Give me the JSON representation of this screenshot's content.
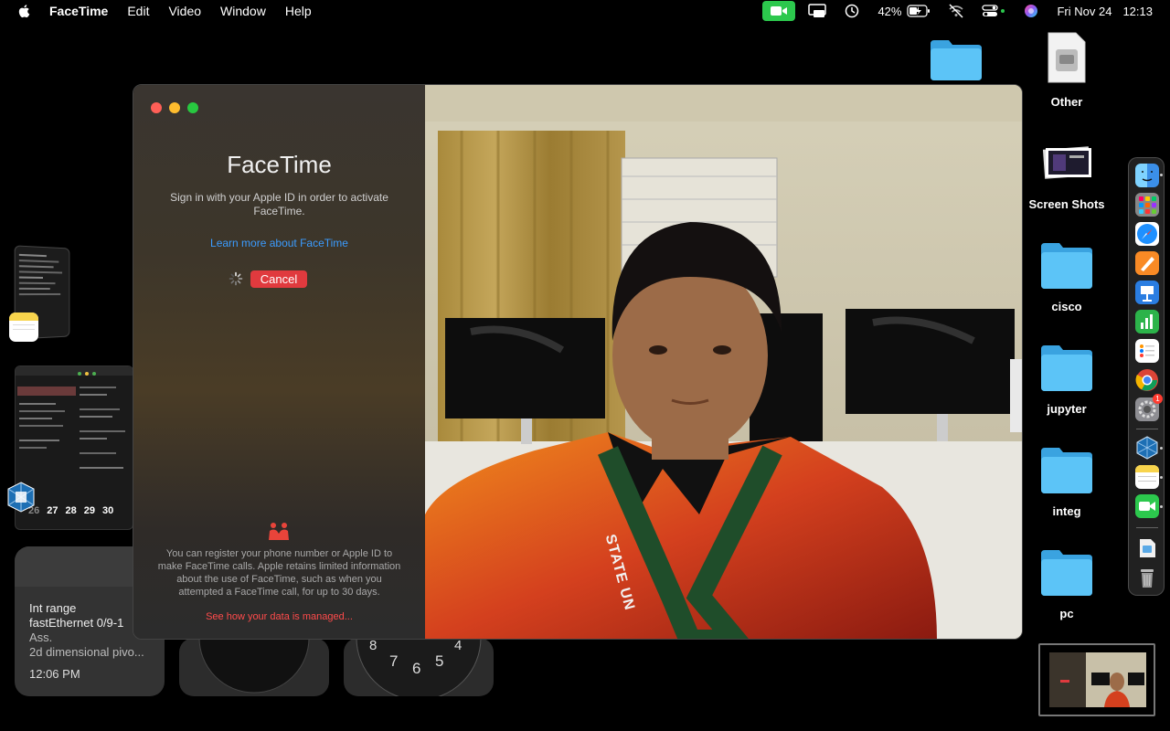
{
  "menubar": {
    "apple_icon": "apple-logo-icon",
    "items": [
      "FaceTime",
      "Edit",
      "Video",
      "Window",
      "Help"
    ],
    "status": {
      "facetime_icon": "video-camera-icon",
      "screen_mirroring_icon": "screen-share-icon",
      "time_machine_icon": "clock-history-icon",
      "battery_percent": "42%",
      "battery_icon": "battery-charging-icon",
      "wifi_icon": "wifi-off-icon",
      "control_center_icon": "control-center-icon",
      "siri_icon": "siri-icon",
      "date": "Fri Nov 24",
      "time": "12:13"
    }
  },
  "desktop": {
    "icons": [
      "Other",
      "Screen Shots",
      "cisco",
      "jupyter",
      "integ",
      "pc"
    ]
  },
  "widgets": {
    "note": {
      "line1": "Int range",
      "line2": "fastEthernet 0/9-1",
      "line3": "Ass.",
      "line4": "2d dimensional pivo...",
      "time": "12:06 PM"
    },
    "calendar_days": [
      "26",
      "27",
      "28",
      "29",
      "30"
    ],
    "clock_numbers": [
      "8",
      "7",
      "6",
      "5",
      "4"
    ]
  },
  "facetime": {
    "title": "FaceTime",
    "subtitle": "Sign in with your Apple ID in order to activate FaceTime.",
    "learn_more": "Learn more about FaceTime",
    "cancel": "Cancel",
    "note": "You can register your phone number or Apple ID to make FaceTime calls. Apple retains limited information about the use of FaceTime, such as when you attempted a FaceTime call, for up to 30 days.",
    "data_link": "See how your data is managed...",
    "camera_lanyard_text": "STATE UN",
    "colors": {
      "close": "#ff5f57",
      "minimize": "#febc2e",
      "zoom": "#28c840",
      "cancel": "#e03a3e",
      "link": "#3b9cff",
      "data_link": "#ff4b4b"
    }
  },
  "dock": {
    "apps": [
      "finder-icon",
      "launchpad-icon",
      "safari-icon",
      "pages-icon",
      "keynote-icon",
      "numbers-icon",
      "reminders-icon",
      "chrome-icon",
      "system-settings-icon",
      "virtualbox-icon",
      "notes-icon",
      "facetime-icon",
      "downloads-icon",
      "trash-icon"
    ],
    "settings_badge": "1"
  }
}
